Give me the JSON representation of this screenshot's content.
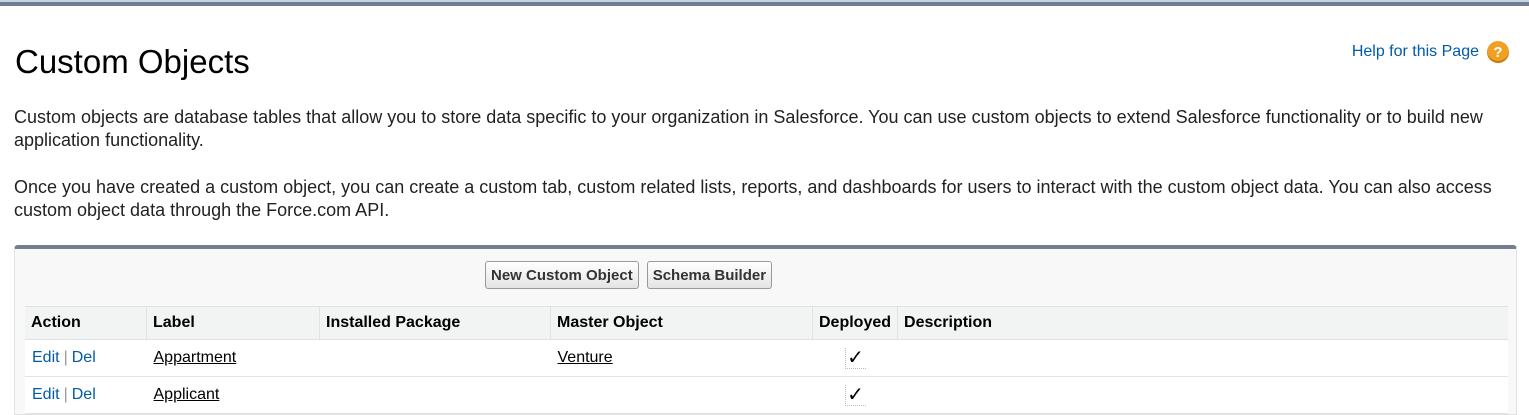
{
  "page": {
    "title": "Custom Objects",
    "help_link": "Help for this Page",
    "help_icon": "help-icon",
    "description_1": "Custom objects are database tables that allow you to store data specific to your organization in Salesforce. You can use custom objects to extend Salesforce functionality or to build new application functionality.",
    "description_2": "Once you have created a custom object, you can create a custom tab, custom related lists, reports, and dashboards for users to interact with the custom object data. You can also access custom object data through the Force.com API."
  },
  "toolbar": {
    "new_button": "New Custom Object",
    "schema_button": "Schema Builder"
  },
  "table": {
    "headers": {
      "action": "Action",
      "label": "Label",
      "installed_package": "Installed Package",
      "master_object": "Master Object",
      "deployed": "Deployed",
      "description": "Description"
    },
    "rows": [
      {
        "edit": "Edit",
        "sep": "|",
        "del": "Del",
        "label": "Appartment",
        "installed_package": "",
        "master_object": "Venture",
        "deployed": "✓",
        "description": ""
      },
      {
        "edit": "Edit",
        "sep": "|",
        "del": "Del",
        "label": "Applicant",
        "installed_package": "",
        "master_object": "",
        "deployed": "✓",
        "description": ""
      }
    ]
  },
  "colors": {
    "link": "#015ba7",
    "header_bar": "#747e8c",
    "help_icon": "#f0a022"
  }
}
